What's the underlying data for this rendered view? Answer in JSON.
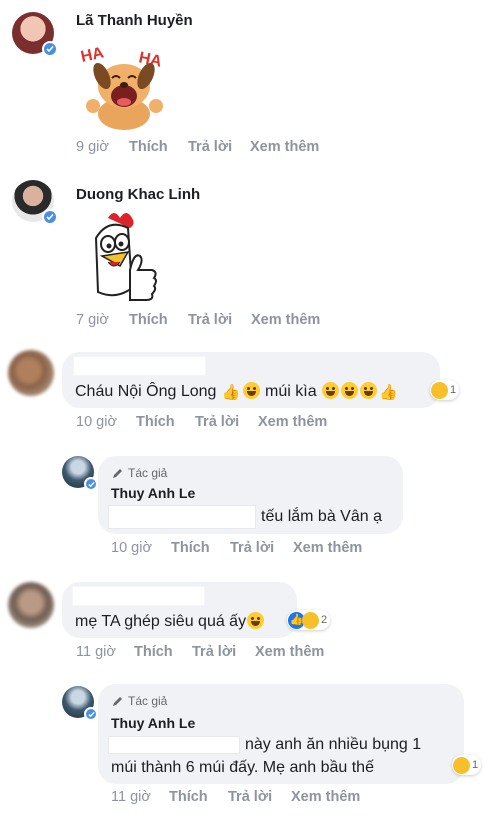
{
  "comments": [
    {
      "name": "Lã Thanh Huyền",
      "sticker": "haha-dog-sticker",
      "sticker_text": "HA HA",
      "time": "9 giờ",
      "actions": [
        "Thích",
        "Trả lời",
        "Xem thêm"
      ]
    },
    {
      "name": "Duong Khac Linh",
      "sticker": "rooster-thumbs-up-sticker",
      "time": "7 giờ",
      "actions": [
        "Thích",
        "Trả lời",
        "Xem thêm"
      ]
    },
    {
      "text_a": "Cháu Nội Ông Long",
      "text_b": "múi kìa",
      "reaction_count": "1",
      "time": "10 giờ",
      "actions": [
        "Thích",
        "Trả lời",
        "Xem thêm"
      ]
    },
    {
      "author_tag": "Tác giả",
      "name": "Thuy Anh Le",
      "text": "tếu lắm bà Vân ạ",
      "time": "10 giờ",
      "actions": [
        "Thích",
        "Trả lời",
        "Xem thêm"
      ]
    },
    {
      "text": "mẹ TA ghép siêu quá ấy",
      "reaction_count": "2",
      "time": "11 giờ",
      "actions": [
        "Thích",
        "Trả lời",
        "Xem thêm"
      ]
    },
    {
      "author_tag": "Tác giả",
      "name": "Thuy Anh Le",
      "text_line1": "này anh ăn nhiều bụng 1",
      "text_line2": "múi thành 6 múi đấy. Mẹ anh bầu thế",
      "reaction_count": "1",
      "time": "11 giờ",
      "actions": [
        "Thích",
        "Trả lời",
        "Xem thêm"
      ]
    }
  ],
  "colors": {
    "meta": "#8d949e",
    "bubble": "#f0f2f5",
    "verified": "#4a90e2",
    "like": "#1877f2"
  }
}
